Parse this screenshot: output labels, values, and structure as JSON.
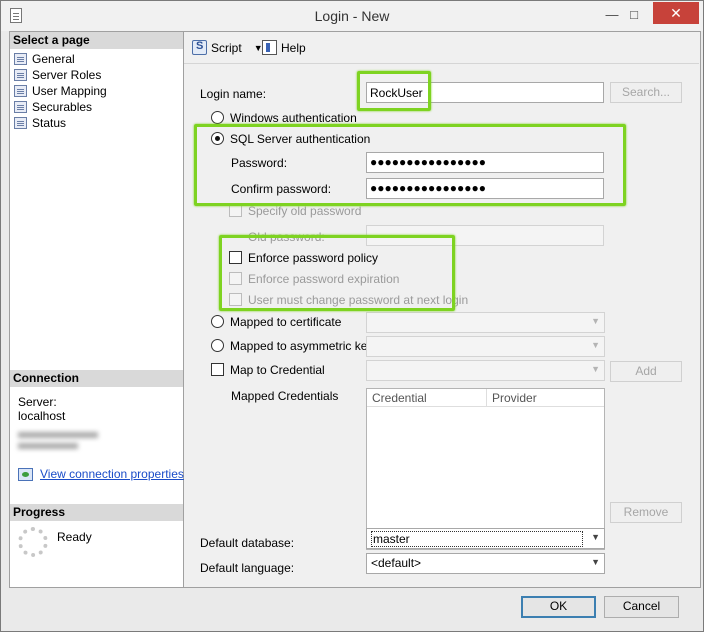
{
  "window": {
    "title": "Login - New"
  },
  "select_page": {
    "header": "Select a page",
    "items": [
      {
        "label": "General"
      },
      {
        "label": "Server Roles"
      },
      {
        "label": "User Mapping"
      },
      {
        "label": "Securables"
      },
      {
        "label": "Status"
      }
    ]
  },
  "connection": {
    "header": "Connection",
    "server_label": "Server:",
    "server_value": "localhost",
    "link_text": "View connection properties"
  },
  "progress": {
    "header": "Progress",
    "status": "Ready"
  },
  "toolbar": {
    "script_label": "Script",
    "help_label": "Help"
  },
  "form": {
    "login_name_label": "Login name:",
    "login_name_value": "RockUser",
    "search_button": "Search...",
    "windows_auth_label": "Windows authentication",
    "sql_auth_label": "SQL Server authentication",
    "password_label": "Password:",
    "password_value": "●●●●●●●●●●●●●●●●",
    "confirm_password_label": "Confirm password:",
    "confirm_password_value": "●●●●●●●●●●●●●●●●",
    "specify_old_password_label": "Specify old password",
    "old_password_label": "Old password:",
    "enforce_policy_label": "Enforce password policy",
    "enforce_expiration_label": "Enforce password expiration",
    "must_change_label": "User must change password at next login",
    "mapped_certificate_label": "Mapped to certificate",
    "mapped_asym_key_label": "Mapped to asymmetric key",
    "map_credential_label": "Map to Credential",
    "add_button": "Add",
    "mapped_credentials_label": "Mapped Credentials",
    "credential_col": "Credential",
    "provider_col": "Provider",
    "remove_button": "Remove",
    "default_database_label": "Default database:",
    "default_database_value": "master",
    "default_language_label": "Default language:",
    "default_language_value": "<default>"
  },
  "footer": {
    "ok_label": "OK",
    "cancel_label": "Cancel"
  },
  "colors": {
    "highlight": "#7ed321",
    "link": "#1a4cc8",
    "close_button": "#c7423a"
  }
}
